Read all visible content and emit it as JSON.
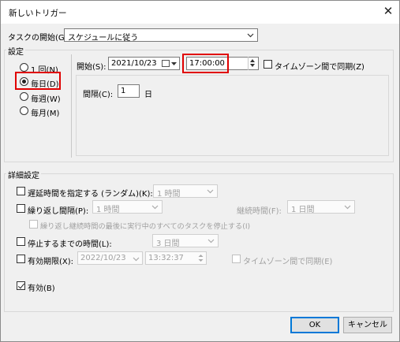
{
  "window": {
    "title": "新しいトリガー",
    "close_glyph": "✕"
  },
  "task_start": {
    "label": "タスクの開始(G):",
    "value": "スケジュールに従う"
  },
  "settings": {
    "group_label": "設定",
    "radios": [
      {
        "label": "1 回(N)",
        "checked": false
      },
      {
        "label": "毎日(D)",
        "checked": true
      },
      {
        "label": "毎週(W)",
        "checked": false
      },
      {
        "label": "毎月(M)",
        "checked": false
      }
    ],
    "start_label": "開始(S):",
    "start_date": "2021/10/23",
    "start_time": "17:00:00",
    "sync_timezone_label": "タイムゾーン間で同期(Z)",
    "interval_label": "間隔(C):",
    "interval_value": "1",
    "interval_unit": "日"
  },
  "advanced": {
    "group_label": "詳細設定",
    "delay": {
      "label": "遅延時間を指定する (ランダム)(K):",
      "value": "1 時間",
      "checked": false
    },
    "repeat": {
      "label": "繰り返し間隔(P):",
      "value": "1 時間",
      "checked": false
    },
    "duration": {
      "label": "継続時間(F):",
      "value": "1 日間"
    },
    "stop_all": {
      "label": "繰り返し継続時間の最後に実行中のすべてのタスクを停止する(I)",
      "checked": false
    },
    "stop_after": {
      "label": "停止するまでの時間(L):",
      "value": "3 日間",
      "checked": false
    },
    "expire": {
      "label": "有効期限(X):",
      "date": "2022/10/23",
      "time": "13:32:37",
      "checked": false
    },
    "expire_sync": {
      "label": "タイムゾーン間で同期(E)",
      "checked": false
    },
    "enabled": {
      "label": "有効(B)",
      "checked": true
    }
  },
  "buttons": {
    "ok": "OK",
    "cancel": "キャンセル"
  },
  "colors": {
    "highlight": "#e00000",
    "accent": "#0078d7"
  }
}
